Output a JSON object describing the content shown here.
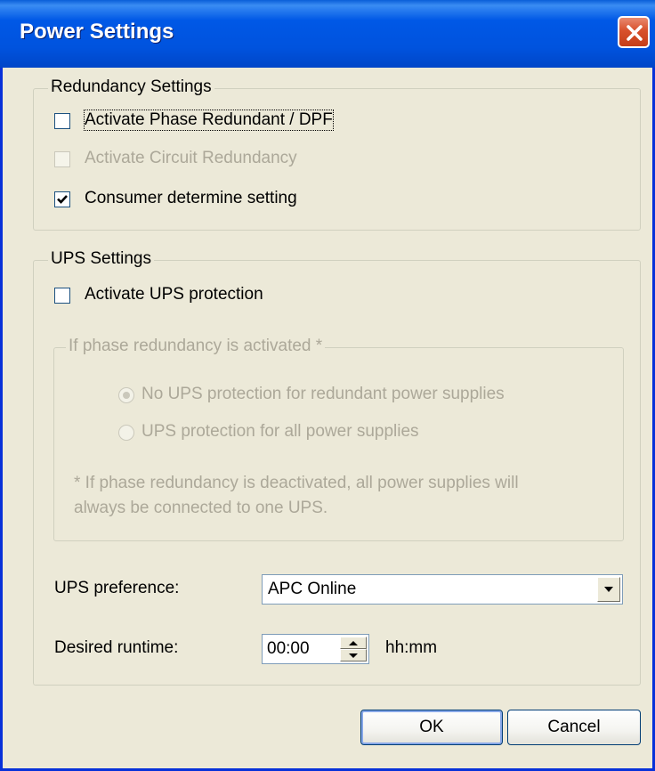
{
  "window": {
    "title": "Power Settings"
  },
  "redundancy": {
    "title": "Redundancy Settings",
    "phase_redundant": {
      "label": "Activate Phase Redundant / DPF",
      "checked": false,
      "enabled": true
    },
    "circuit_redundancy": {
      "label": "Activate Circuit Redundancy",
      "checked": false,
      "enabled": false
    },
    "consumer_determine": {
      "label": "Consumer determine setting",
      "checked": true,
      "enabled": true
    }
  },
  "ups": {
    "title": "UPS Settings",
    "activate": {
      "label": "Activate UPS protection",
      "checked": false,
      "enabled": true
    },
    "phase_group": {
      "title": "If phase redundancy is activated *",
      "options": [
        {
          "label": "No UPS protection for redundant power supplies",
          "selected": true
        },
        {
          "label": "UPS protection for all power supplies",
          "selected": false
        }
      ],
      "note_line1": "* If phase redundancy is deactivated, all power supplies will",
      "note_line2": "always be connected to one UPS."
    },
    "preference_label": "UPS preference:",
    "preference_value": "APC Online",
    "runtime_label": "Desired runtime:",
    "runtime_value": "00:00",
    "runtime_unit": "hh:mm"
  },
  "buttons": {
    "ok": "OK",
    "cancel": "Cancel"
  },
  "colors": {
    "title_bar": "#0054e3",
    "dialog_bg": "#ece9d8",
    "disabled_text": "#aca899",
    "close_button": "#d8502b"
  }
}
